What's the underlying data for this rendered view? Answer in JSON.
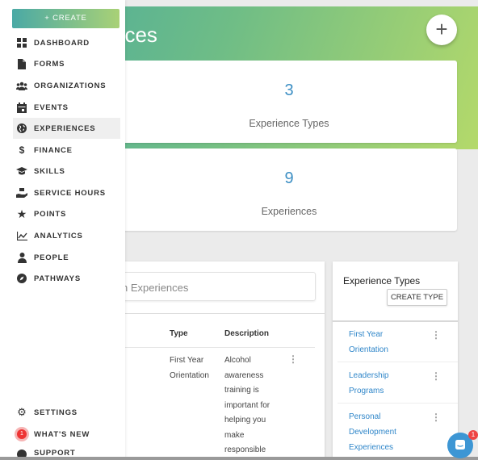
{
  "header": {
    "title": "nces"
  },
  "stats": [
    {
      "value": "3",
      "label": "Experience Types"
    },
    {
      "value": "9",
      "label": "Experiences"
    }
  ],
  "search": {
    "placeholder": "n Experiences"
  },
  "table": {
    "columns": [
      "Type",
      "Description"
    ],
    "rows": [
      {
        "type_lines": [
          "First Year",
          "Orientation"
        ],
        "description_lines": [
          "Alcohol",
          "awareness",
          "training is",
          "important for",
          "helping you",
          "make",
          "responsible"
        ]
      }
    ]
  },
  "experience_types": {
    "title": "Experience Types",
    "create_label": "CREATE TYPE",
    "items": [
      {
        "lines": [
          "First Year",
          "Orientation"
        ]
      },
      {
        "lines": [
          "Leadership",
          "Programs"
        ]
      },
      {
        "lines": [
          "Personal",
          "Development",
          "Experiences"
        ]
      }
    ]
  },
  "sidebar": {
    "create_label": "+ CREATE",
    "items": [
      {
        "label": "DASHBOARD",
        "icon": "dashboard-icon"
      },
      {
        "label": "FORMS",
        "icon": "document-icon"
      },
      {
        "label": "ORGANIZATIONS",
        "icon": "people-group-icon"
      },
      {
        "label": "EVENTS",
        "icon": "calendar-icon"
      },
      {
        "label": "EXPERIENCES",
        "icon": "globe-icon",
        "active": true
      },
      {
        "label": "FINANCE",
        "icon": "dollar-icon"
      },
      {
        "label": "SKILLS",
        "icon": "graduation-cap-icon"
      },
      {
        "label": "SERVICE HOURS",
        "icon": "hand-holding-icon"
      },
      {
        "label": "POINTS",
        "icon": "star-icon"
      },
      {
        "label": "ANALYTICS",
        "icon": "line-chart-icon"
      },
      {
        "label": "PEOPLE",
        "icon": "person-icon"
      },
      {
        "label": "PATHWAYS",
        "icon": "compass-icon"
      }
    ],
    "bottom": [
      {
        "label": "SETTINGS",
        "icon": "gear-icon"
      },
      {
        "label": "WHAT'S NEW",
        "icon": "notification-icon",
        "badge": "1"
      },
      {
        "label": "SUPPORT",
        "icon": "help-icon"
      }
    ]
  },
  "chat": {
    "badge": "1"
  },
  "colors": {
    "accent_start": "#49aa9e",
    "accent_end": "#b4d96a",
    "link": "#2f86c9",
    "stat_number": "#3d8fc4"
  }
}
